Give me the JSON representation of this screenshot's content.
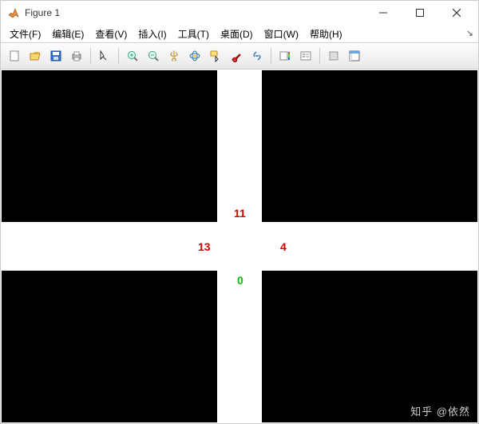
{
  "window": {
    "title": "Figure 1"
  },
  "menus": {
    "file": "文件(F)",
    "edit": "编辑(E)",
    "view": "查看(V)",
    "insert": "插入(I)",
    "tools": "工具(T)",
    "desktop": "桌面(D)",
    "window_menu": "窗口(W)",
    "help": "帮助(H)"
  },
  "labels": {
    "top": "11",
    "left": "13",
    "right": "4",
    "bottom": "0"
  },
  "watermark": "知乎 @依然",
  "icons": {
    "new": "new-file",
    "open": "open-folder",
    "save": "floppy",
    "print": "printer",
    "pointer": "cursor",
    "zoomin": "zoom-in",
    "zoomout": "zoom-out",
    "pan": "hand",
    "rotate": "rotate-3d",
    "datacursor": "data-cursor",
    "brush": "brush",
    "link": "link",
    "colorbar": "colorbar",
    "legend": "legend",
    "grid": "grid",
    "dock": "dock"
  }
}
